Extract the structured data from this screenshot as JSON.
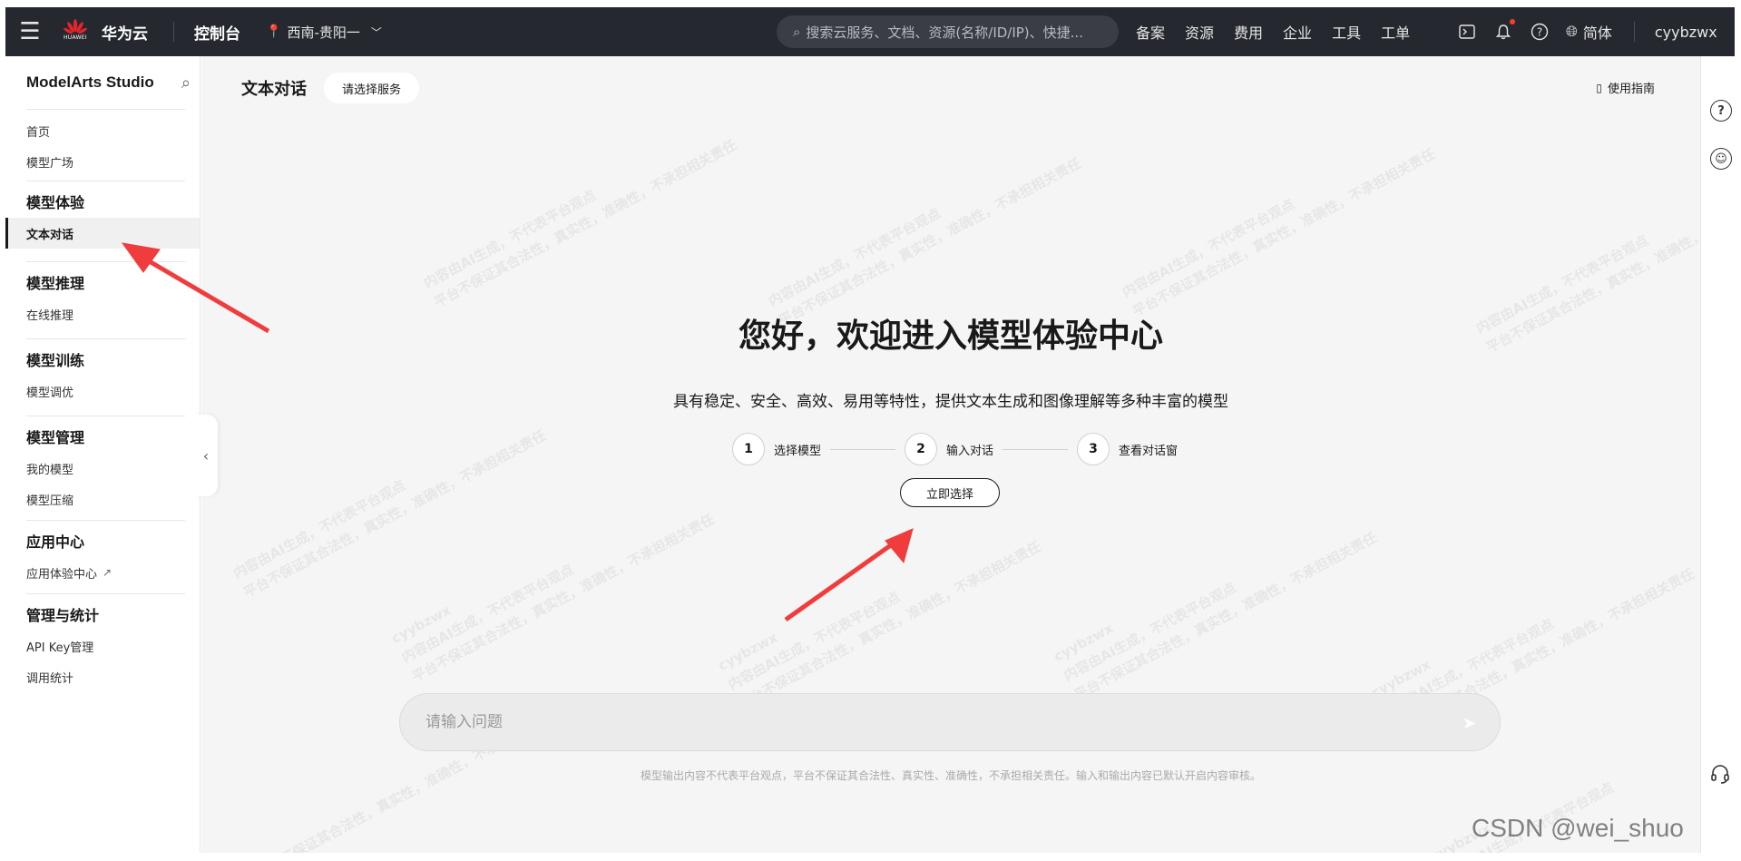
{
  "topbar": {
    "menu_icon": "hamburger-icon",
    "logo_sub": "HUAWEI",
    "brand": "华为云",
    "console": "控制台",
    "region": "西南-贵阳一",
    "search_placeholder": "搜索云服务、文档、资源(名称/ID/IP)、快捷...",
    "links": [
      "备案",
      "资源",
      "费用",
      "企业",
      "工具",
      "工单"
    ],
    "lang": "简体",
    "user": "cyybzwx"
  },
  "sidebar": {
    "title": "ModelArts Studio",
    "home": "首页",
    "model_square": "模型广场",
    "group_experience": "模型体验",
    "text_chat": "文本对话",
    "group_inference": "模型推理",
    "online_inference": "在线推理",
    "group_training": "模型训练",
    "model_tuning": "模型调优",
    "group_management": "模型管理",
    "my_models": "我的模型",
    "model_compress": "模型压缩",
    "group_app": "应用中心",
    "app_center": "应用体验中心",
    "group_stats": "管理与统计",
    "api_key": "API Key管理",
    "usage_stats": "调用统计"
  },
  "main": {
    "title": "文本对话",
    "select_service": "请选择服务",
    "guide": "使用指南",
    "welcome": "您好，欢迎进入模型体验中心",
    "subtitle": "具有稳定、安全、高效、易用等特性，提供文本生成和图像理解等多种丰富的模型",
    "steps": [
      {
        "num": "1",
        "label": "选择模型"
      },
      {
        "num": "2",
        "label": "输入对话"
      },
      {
        "num": "3",
        "label": "查看对话窗"
      }
    ],
    "select_now": "立即选择",
    "input_placeholder": "请输入问题",
    "disclaimer": "模型输出内容不代表平台观点，平台不保证其合法性、真实性、准确性，不承担相关责任。输入和输出内容已默认开启内容审核。"
  },
  "watermark": {
    "line1": "内容由AI生成，不代表平台观点",
    "line2": "平台不保证其合法性，真实性，准确性，不承担相关责任",
    "user": "cyybzwx"
  },
  "annotation": {
    "csdn": "CSDN @wei_shuo",
    "arrow_color": "#f03c3c"
  }
}
